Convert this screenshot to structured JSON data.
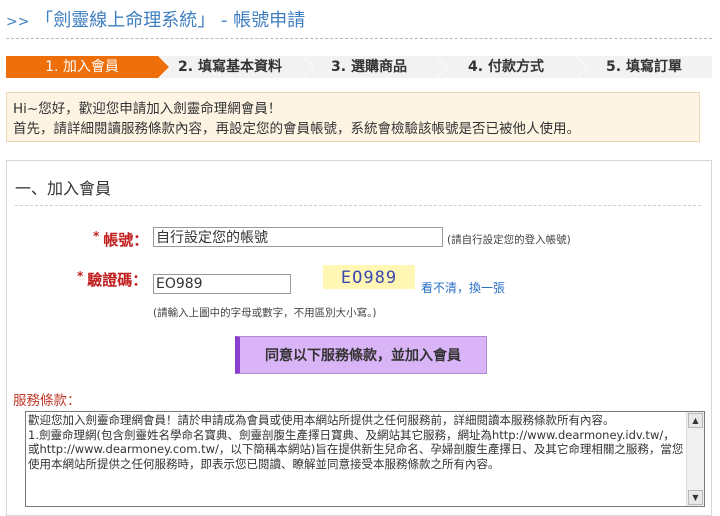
{
  "header": {
    "arrows": ">>",
    "title": "「劍靈線上命理系統」 - 帳號申請"
  },
  "steps": [
    {
      "label": "1. 加入會員",
      "active": true
    },
    {
      "label": "2. 填寫基本資料",
      "active": false
    },
    {
      "label": "3. 選購商品",
      "active": false
    },
    {
      "label": "4. 付款方式",
      "active": false
    },
    {
      "label": "5. 填寫訂單",
      "active": false
    }
  ],
  "intro": {
    "line1": "Hi~您好，歡迎您申請加入劍靈命理網會員！",
    "line2": "首先，請詳細閱讀服務條款內容，再設定您的會員帳號，系統會檢驗該帳號是否已被他人使用。"
  },
  "form": {
    "section_title": "一、加入會員",
    "required_mark": "*",
    "account_label": "帳號：",
    "account_value": "自行設定您的帳號",
    "account_hint": "(請自行設定您的登入帳號)",
    "captcha_label": "驗證碼：",
    "captcha_value": "EO989",
    "captcha_image_text": "EO989",
    "captcha_refresh": "看不清，換一張",
    "captcha_hint": "(請輸入上圖中的字母或數字，不用區別大小寫。)",
    "agree_button": "同意以下服務條款，並加入會員"
  },
  "terms": {
    "label": "服務條款：",
    "text": "歡迎您加入劍靈命理網會員！請於申請成為會員或使用本網站所提供之任何服務前，詳細閱讀本服務條款所有內容。\n1.劍靈命理網(包含劍靈姓名學命名寶典、劍靈剖腹生產擇日寶典、及網站其它服務，網址為http://www.dearmoney.idv.tw/，或http://www.dearmoney.com.tw/，以下簡稱本網站)旨在提供新生兒命名、孕婦剖腹生產擇日、及其它命理相關之服務，當您使用本網站所提供之任何服務時，即表示您已閱讀、瞭解並同意接受本服務條款之所有內容。"
  },
  "colors": {
    "accent": "#ee6e0a",
    "title": "#3f7fc0",
    "required": "#c02020",
    "button": "#d9b4f6"
  }
}
